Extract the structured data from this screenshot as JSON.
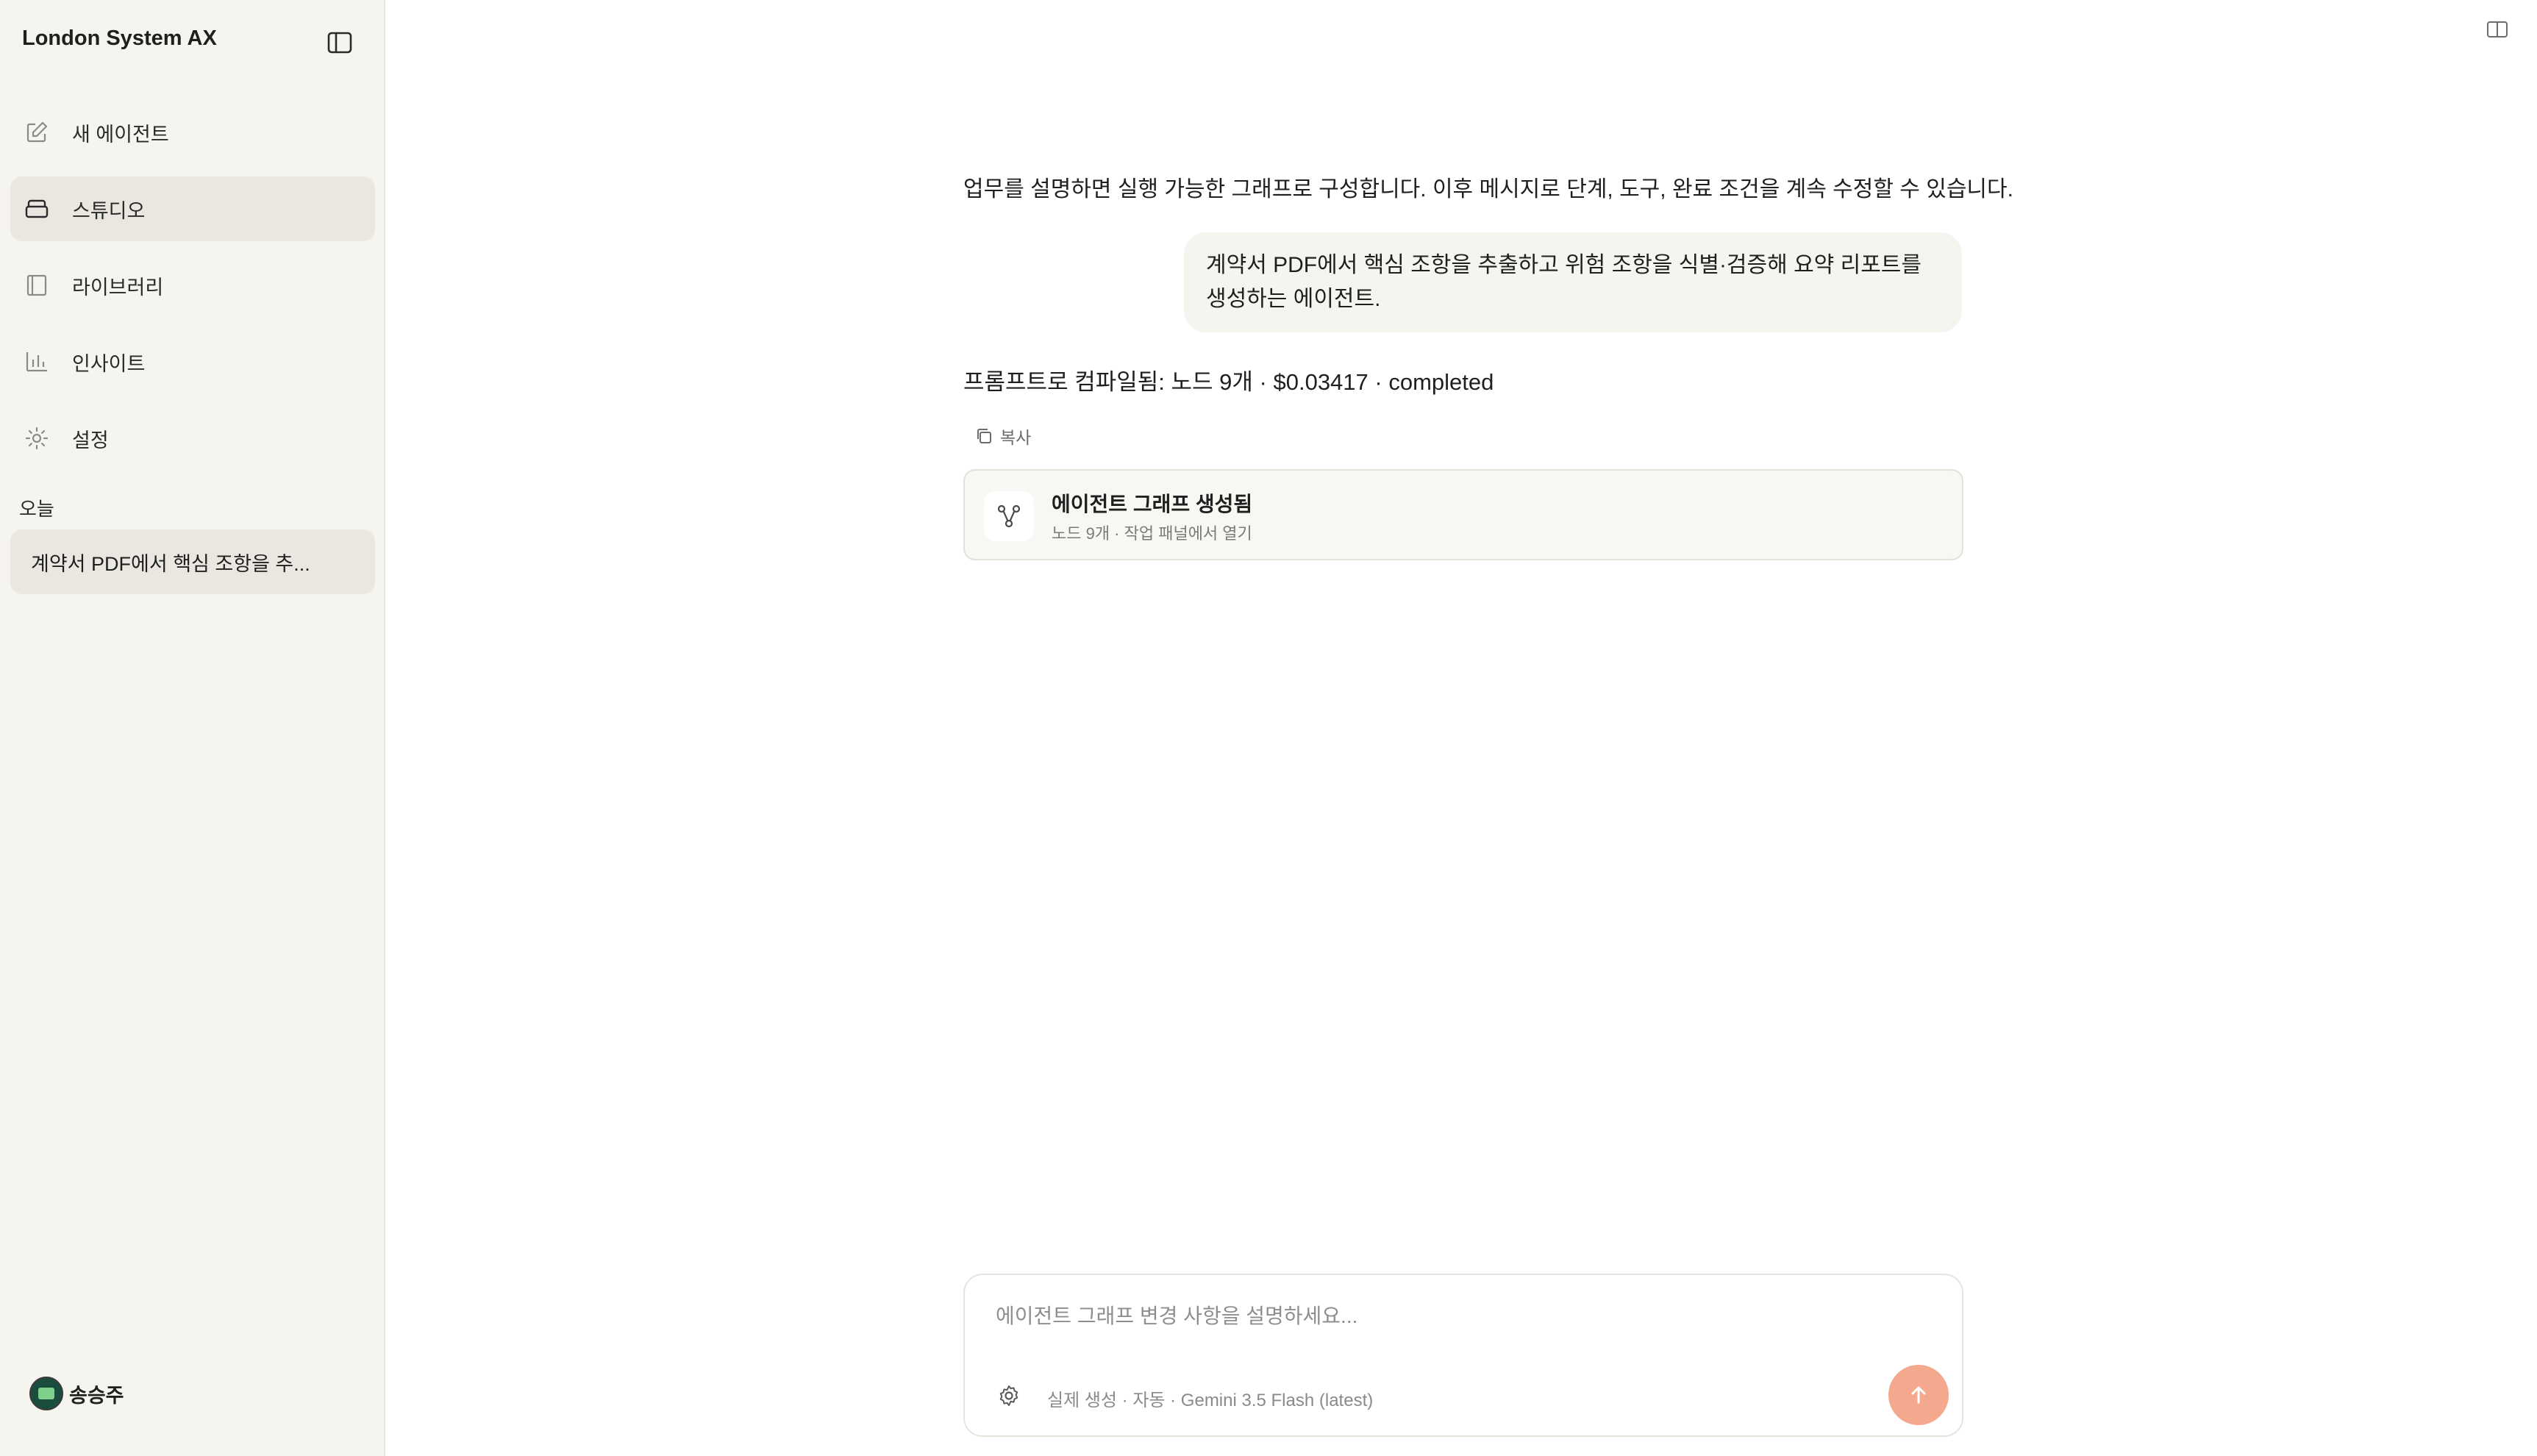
{
  "sidebar": {
    "brand": "London System AX",
    "nav": [
      {
        "label": "새 에이전트",
        "icon": "edit-icon"
      },
      {
        "label": "스튜디오",
        "icon": "studio-icon",
        "active": true
      },
      {
        "label": "라이브러리",
        "icon": "library-icon"
      },
      {
        "label": "인사이트",
        "icon": "chart-icon"
      },
      {
        "label": "설정",
        "icon": "settings-icon"
      }
    ],
    "section_today": "오늘",
    "history": [
      {
        "label": "계약서 PDF에서 핵심 조항을 추..."
      }
    ],
    "user": {
      "name": "송승주"
    }
  },
  "main": {
    "intro": "업무를 설명하면 실행 가능한 그래프로 구성합니다. 이후 메시지로 단계, 도구, 완료 조건을 계속 수정할 수 있습니다.",
    "user_message": "계약서 PDF에서 핵심 조항을 추출하고 위험 조항을 식별·검증해 요약 리포트를 생성하는 에이전트.",
    "compiled_status": "프롬프트로 컴파일됨: 노드 9개 · $0.03417 · completed",
    "copy_label": "복사",
    "graph_card": {
      "title": "에이전트 그래프 생성됨",
      "subtitle": "노드 9개 · 작업 패널에서 열기"
    }
  },
  "composer": {
    "placeholder": "에이전트 그래프 변경 사항을 설명하세요...",
    "meta": "실제 생성 · 자동 · Gemini 3.5 Flash (latest)"
  },
  "colors": {
    "sidebar_bg": "#f5f4ef",
    "active_item_bg": "#e9e7e0",
    "send_button": "#f4a98e"
  }
}
